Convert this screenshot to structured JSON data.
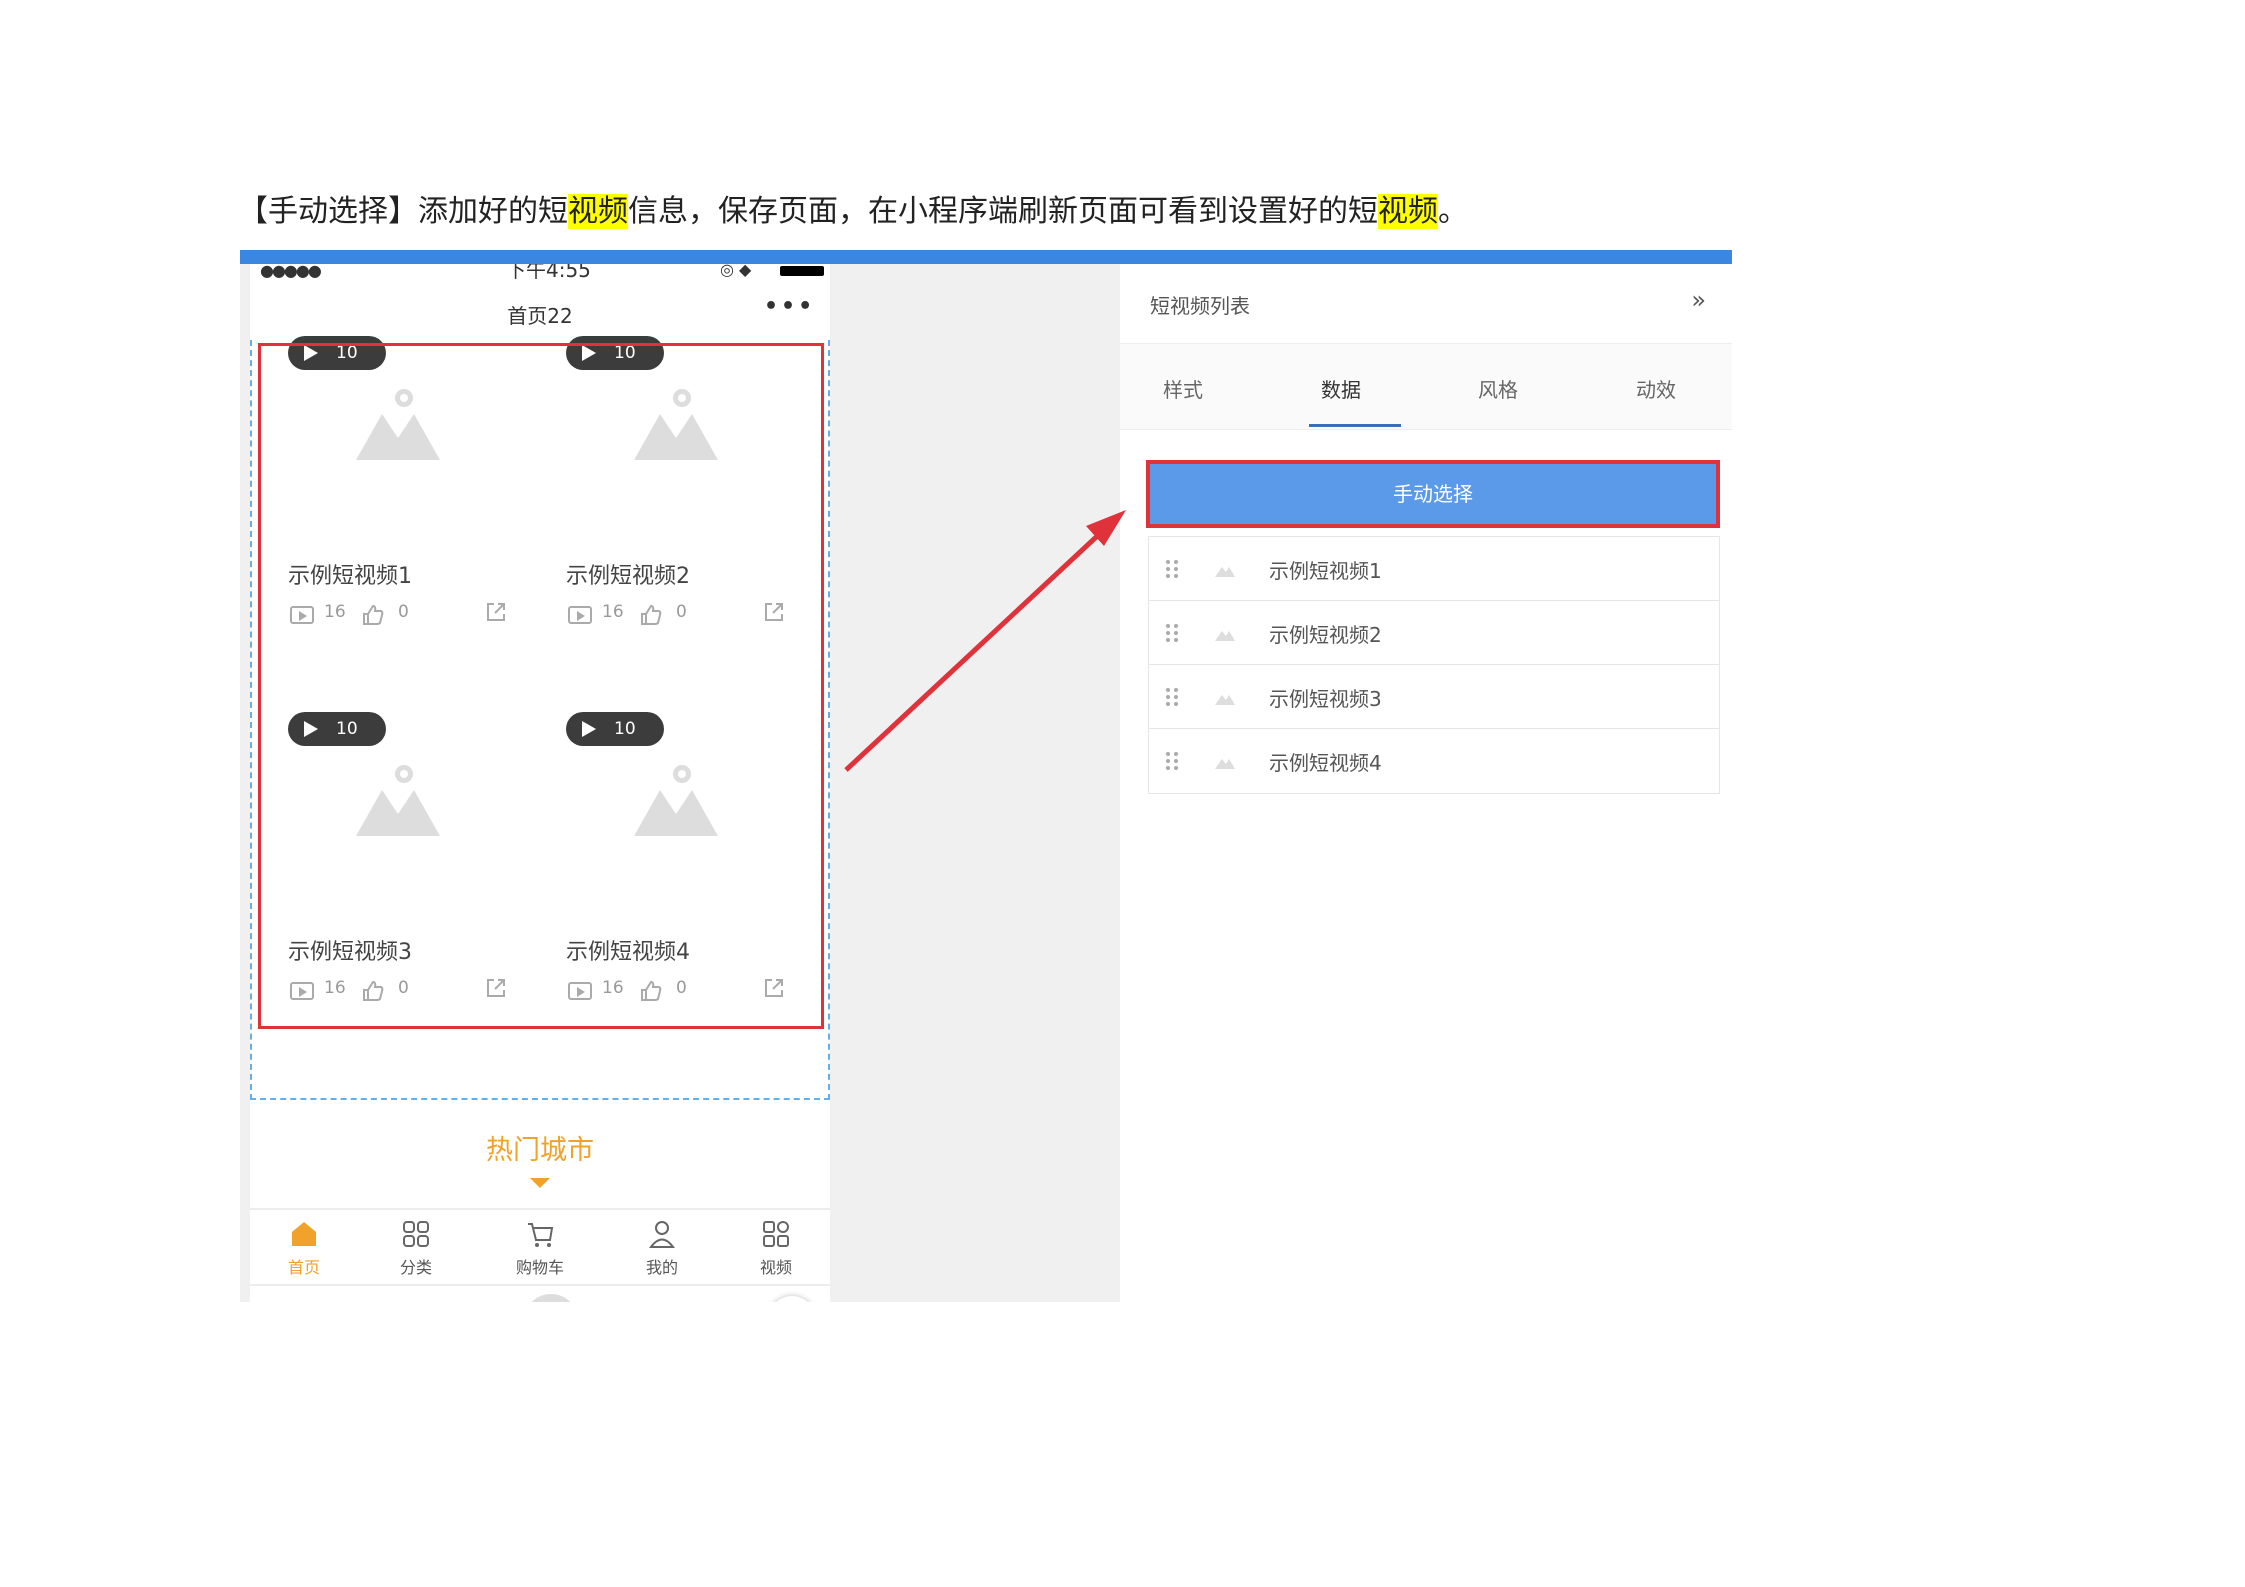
{
  "doc": {
    "part1": "【手动选择】添加好的短",
    "hl1": "视频",
    "part2": "信息，保存页面，在小程序端刷新页面可看到设置好的短",
    "hl2": "视频",
    "part3": "。"
  },
  "phone": {
    "status_time": "下午4:55",
    "nav_title": "首页22",
    "nav_more": "•••",
    "cards": [
      {
        "badge": "10",
        "title": "示例短视频1",
        "plays": "16",
        "likes": "0"
      },
      {
        "badge": "10",
        "title": "示例短视频2",
        "plays": "16",
        "likes": "0"
      },
      {
        "badge": "10",
        "title": "示例短视频3",
        "plays": "16",
        "likes": "0"
      },
      {
        "badge": "10",
        "title": "示例短视频4",
        "plays": "16",
        "likes": "0"
      }
    ],
    "hot_title": "热门城市",
    "tabs": [
      "首页",
      "分类",
      "购物车",
      "我的",
      "视频"
    ]
  },
  "panel": {
    "title": "短视频列表",
    "chevron": "»",
    "tabs": [
      "样式",
      "数据",
      "风格",
      "动效"
    ],
    "active_tab": "数据",
    "manual_button": "手动选择",
    "items": [
      "示例短视频1",
      "示例短视频2",
      "示例短视频3",
      "示例短视频4"
    ]
  },
  "colors": {
    "accent_blue": "#3b86e0",
    "button_blue": "#5b9ae8",
    "highlight_red": "#e0323a",
    "orange": "#f0a22a",
    "text_highlight": "#ffff00"
  }
}
